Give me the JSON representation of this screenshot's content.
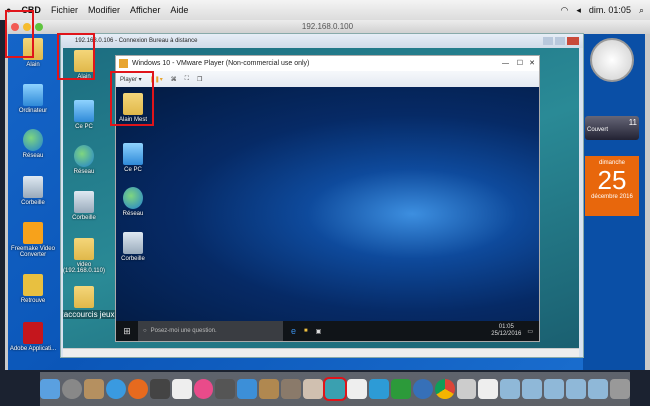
{
  "menubar": {
    "app": "CBD",
    "items": [
      "Fichier",
      "Modifier",
      "Afficher",
      "Aide"
    ],
    "clock": "dim. 01:05"
  },
  "outer_window": {
    "title": "192.168.0.100"
  },
  "win7_icons": [
    "Alain",
    "Ordinateur",
    "Réseau",
    "Corbeille",
    "Freemake Video Converter",
    "Retrouve",
    "Adobe Applicati..."
  ],
  "gadgets": {
    "weather_temp": "11",
    "weather_text": "Couvert",
    "cal_day": "dimanche",
    "cal_date": "25",
    "cal_month": "décembre 2016"
  },
  "rdp_window": {
    "title": "192.168.0.106 - Connexion Bureau à distance"
  },
  "rdp_icons": [
    "Alain",
    "Ce PC",
    "Réseau",
    "Corbeille",
    "video (192.168.0.110)",
    "Raccourcis jeux"
  ],
  "vm_window": {
    "title": "Windows 10 - VMware Player (Non-commercial use only)",
    "player_menu": "Player ▾"
  },
  "win10_icons": [
    "Alain Mest",
    "Ce PC",
    "Réseau",
    "Corbeille"
  ],
  "win10_taskbar": {
    "search_placeholder": "Posez-moi une question.",
    "time": "01:05",
    "date": "25/12/2016"
  },
  "colors": {
    "highlight": "#e0141a"
  }
}
